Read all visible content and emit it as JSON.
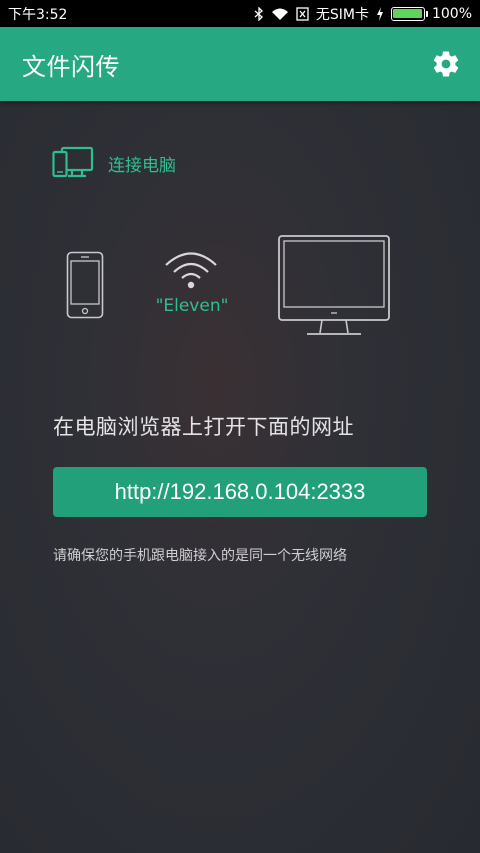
{
  "status_bar": {
    "time": "下午3:52",
    "carrier": "无SIM卡",
    "battery": "100%",
    "battery_level": 1.0
  },
  "app_bar": {
    "title": "文件闪传",
    "settings_icon": "gear-icon"
  },
  "connect": {
    "label": "连接电脑",
    "icon": "phone-computer-icon"
  },
  "illustration": {
    "ssid": "\"Eleven\"",
    "phone_icon": "smartphone-icon",
    "wifi_icon": "wifi-icon",
    "monitor_icon": "monitor-icon"
  },
  "instruction": "在电脑浏览器上打开下面的网址",
  "url": "http://192.168.0.104:2333",
  "note": "请确保您的手机跟电脑接入的是同一个无线网络",
  "colors": {
    "accent": "#26a882",
    "accent_text": "#2fbf8f",
    "background": "#2b2d34"
  }
}
